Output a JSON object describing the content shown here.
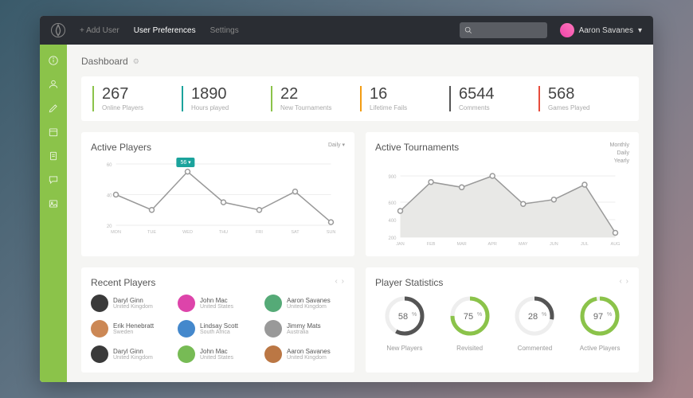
{
  "topbar": {
    "nav": [
      {
        "label": "+ Add User",
        "active": false
      },
      {
        "label": "User Preferences",
        "active": true
      },
      {
        "label": "Settings",
        "active": false
      }
    ],
    "user_name": "Aaron Savanes"
  },
  "breadcrumb": {
    "title": "Dashboard"
  },
  "stats": [
    {
      "value": "267",
      "label": "Online Players",
      "color": "#8bc34a"
    },
    {
      "value": "1890",
      "label": "Hours played",
      "color": "#1ba39c"
    },
    {
      "value": "22",
      "label": "New Tournaments",
      "color": "#8bc34a"
    },
    {
      "value": "16",
      "label": "Lifetime Fails",
      "color": "#f39c12"
    },
    {
      "value": "6544",
      "label": "Comments",
      "color": "#555"
    },
    {
      "value": "568",
      "label": "Games Played",
      "color": "#e74c3c"
    }
  ],
  "active_players": {
    "title": "Active Players",
    "option": "Daily ▾",
    "tooltip": "56 ▾"
  },
  "active_tournaments": {
    "title": "Active Tournaments",
    "options": [
      "Monthly",
      "Daily",
      "Yearly"
    ]
  },
  "recent_players": {
    "title": "Recent Players",
    "items": [
      {
        "name": "Daryl Ginn",
        "loc": "United Kingdom",
        "bg": "#3a3a3a"
      },
      {
        "name": "John Mac",
        "loc": "United States",
        "bg": "#d4a"
      },
      {
        "name": "Aaron Savanes",
        "loc": "United Kingdom",
        "bg": "#5a7"
      },
      {
        "name": "Erik Henebratt",
        "loc": "Sweden",
        "bg": "#c85"
      },
      {
        "name": "Lindsay Scott",
        "loc": "South Africa",
        "bg": "#48c"
      },
      {
        "name": "Jimmy Mats",
        "loc": "Australia",
        "bg": "#999"
      },
      {
        "name": "Daryl Ginn",
        "loc": "United Kingdom",
        "bg": "#3a3a3a"
      },
      {
        "name": "John Mac",
        "loc": "United States",
        "bg": "#7b5"
      },
      {
        "name": "Aaron Savanes",
        "loc": "United Kingdom",
        "bg": "#b74"
      }
    ]
  },
  "player_stats": {
    "title": "Player Statistics",
    "items": [
      {
        "pct": 58,
        "label": "New Players",
        "color": "#555"
      },
      {
        "pct": 75,
        "label": "Revisited",
        "color": "#8bc34a"
      },
      {
        "pct": 28,
        "label": "Commented",
        "color": "#555"
      },
      {
        "pct": 97,
        "label": "Active Players",
        "color": "#8bc34a"
      }
    ]
  },
  "chart_data": [
    {
      "type": "line",
      "title": "Active Players",
      "categories": [
        "MON",
        "TUE",
        "WED",
        "THU",
        "FRI",
        "SAT",
        "SUN"
      ],
      "values": [
        40,
        30,
        55,
        35,
        30,
        42,
        22
      ],
      "ylim": [
        20,
        60
      ],
      "yticks": [
        20,
        40,
        60
      ],
      "xlabel": "",
      "ylabel": ""
    },
    {
      "type": "line",
      "title": "Active Tournaments",
      "categories": [
        "JAN",
        "FEB",
        "MAR",
        "APR",
        "MAY",
        "JUN",
        "JUL",
        "AUG"
      ],
      "values": [
        500,
        830,
        770,
        900,
        580,
        630,
        800,
        250
      ],
      "ylim": [
        200,
        900
      ],
      "yticks": [
        200,
        400,
        600,
        900
      ],
      "fill": true,
      "xlabel": "",
      "ylabel": ""
    }
  ]
}
